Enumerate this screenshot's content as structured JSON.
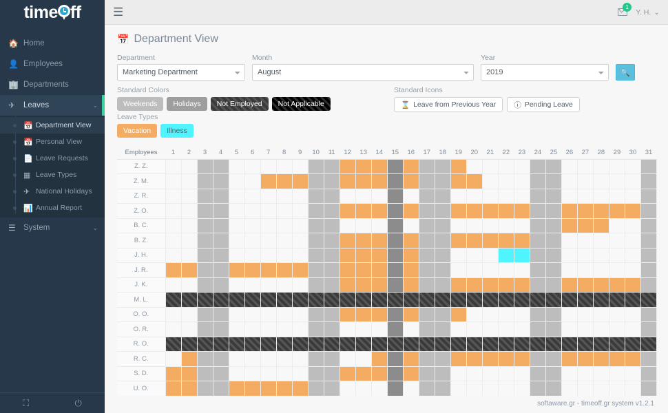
{
  "brand": {
    "name_part1": "time",
    "name_part2": "ff",
    "pin_icon": "location-pin-clock-icon"
  },
  "sidebar": {
    "items": [
      {
        "label": "Home",
        "icon": "home-icon"
      },
      {
        "label": "Employees",
        "icon": "id-card-icon"
      },
      {
        "label": "Departments",
        "icon": "building-icon"
      },
      {
        "label": "Leaves",
        "icon": "paper-plane-icon",
        "chevron": "⌄",
        "active": true
      }
    ],
    "subitems": [
      {
        "label": "Department View",
        "icon": "calendar-icon",
        "active": true
      },
      {
        "label": "Personal View",
        "icon": "calendar-icon",
        "active": false
      },
      {
        "label": "Leave Requests",
        "icon": "document-icon",
        "active": false
      },
      {
        "label": "Leave Types",
        "icon": "grid-icon",
        "active": false
      },
      {
        "label": "National Holidays",
        "icon": "airplane-icon",
        "active": false
      },
      {
        "label": "Annual Report",
        "icon": "bar-chart-icon",
        "active": false
      }
    ],
    "system": {
      "label": "System",
      "icon": "server-icon",
      "chevron": "⌄"
    },
    "bottom": {
      "fullscreen_icon": "expand-icon",
      "power_icon": "power-icon"
    }
  },
  "topbar": {
    "menu_icon": "hamburger-menu-icon",
    "mail_icon": "envelope-icon",
    "mail_badge": "1",
    "user_label": "Y. H.",
    "user_chevron": "⌄"
  },
  "page": {
    "title": "Department View",
    "title_icon": "calendar-icon"
  },
  "filters": {
    "department": {
      "label": "Department",
      "value": "Marketing Department"
    },
    "month": {
      "label": "Month",
      "value": "August"
    },
    "year": {
      "label": "Year",
      "value": "2019"
    },
    "search_icon": "search-icon"
  },
  "legend": {
    "standard_colors_title": "Standard Colors",
    "colors": [
      {
        "label": "Weekends",
        "color": "#bdbdbd"
      },
      {
        "label": "Holidays",
        "color": "#9e9e9e"
      },
      {
        "label": "Not Employed",
        "color": "#3a3a3a"
      },
      {
        "label": "Not Applicable",
        "color": "#000000"
      }
    ],
    "leave_types_title": "Leave Types",
    "leave_types": [
      {
        "label": "Vacation",
        "color": "#f3ac62"
      },
      {
        "label": "Illness",
        "color": "#4ff4ff"
      }
    ],
    "standard_icons_title": "Standard Icons",
    "icons": [
      {
        "label": "Leave from Previous Year",
        "icon": "hourglass-icon",
        "glyph": "⌛"
      },
      {
        "label": "Pending Leave",
        "icon": "clock-icon",
        "glyph": "ⓘ"
      }
    ]
  },
  "calendar": {
    "employees_header": "Employees",
    "days": [
      1,
      2,
      3,
      4,
      5,
      6,
      7,
      8,
      9,
      10,
      11,
      12,
      13,
      14,
      15,
      16,
      17,
      18,
      19,
      20,
      21,
      22,
      23,
      24,
      25,
      26,
      27,
      28,
      29,
      30,
      31
    ],
    "legend_key": {
      "e": "empty",
      "w": "weekend",
      "h": "holiday",
      "v": "vacation",
      "i": "illness",
      "n": "not-employed",
      "x": "not-applicable"
    },
    "rows": [
      {
        "name": "Z. Z.",
        "cells": [
          "e",
          "e",
          "w",
          "w",
          "e",
          "e",
          "e",
          "e",
          "e",
          "w",
          "w",
          "v",
          "v",
          "v",
          "h",
          "v",
          "w",
          "w",
          "v",
          "e",
          "e",
          "e",
          "e",
          "w",
          "w",
          "e",
          "e",
          "e",
          "e",
          "e",
          "w"
        ]
      },
      {
        "name": "Z. M.",
        "cells": [
          "e",
          "e",
          "w",
          "w",
          "e",
          "e",
          "v",
          "v",
          "v",
          "w",
          "w",
          "v",
          "v",
          "v",
          "h",
          "v",
          "w",
          "w",
          "v",
          "v",
          "e",
          "e",
          "e",
          "w",
          "w",
          "e",
          "e",
          "e",
          "e",
          "e",
          "w"
        ]
      },
      {
        "name": "Z. R.",
        "cells": [
          "e",
          "e",
          "w",
          "w",
          "e",
          "e",
          "e",
          "e",
          "e",
          "w",
          "w",
          "e",
          "e",
          "e",
          "h",
          "e",
          "w",
          "w",
          "e",
          "e",
          "e",
          "e",
          "e",
          "w",
          "w",
          "e",
          "e",
          "e",
          "e",
          "e",
          "w"
        ]
      },
      {
        "name": "Z. O.",
        "cells": [
          "e",
          "e",
          "w",
          "w",
          "e",
          "e",
          "e",
          "e",
          "e",
          "w",
          "w",
          "v",
          "v",
          "v",
          "h",
          "v",
          "w",
          "w",
          "v",
          "v",
          "v",
          "v",
          "v",
          "w",
          "w",
          "v",
          "v",
          "v",
          "v",
          "v",
          "w"
        ]
      },
      {
        "name": "B. C.",
        "cells": [
          "e",
          "e",
          "w",
          "w",
          "e",
          "e",
          "e",
          "e",
          "e",
          "w",
          "w",
          "e",
          "e",
          "e",
          "h",
          "e",
          "w",
          "w",
          "e",
          "e",
          "e",
          "e",
          "e",
          "w",
          "w",
          "v",
          "v",
          "v",
          "e",
          "e",
          "w"
        ]
      },
      {
        "name": "B. Z.",
        "cells": [
          "e",
          "e",
          "w",
          "w",
          "e",
          "e",
          "e",
          "e",
          "e",
          "w",
          "w",
          "v",
          "v",
          "v",
          "h",
          "v",
          "w",
          "w",
          "v",
          "v",
          "v",
          "v",
          "v",
          "w",
          "w",
          "e",
          "e",
          "e",
          "e",
          "e",
          "w"
        ]
      },
      {
        "name": "J. H.",
        "cells": [
          "e",
          "e",
          "w",
          "w",
          "e",
          "e",
          "e",
          "e",
          "e",
          "w",
          "w",
          "v",
          "v",
          "v",
          "h",
          "v",
          "w",
          "w",
          "e",
          "e",
          "e",
          "i",
          "i",
          "w",
          "w",
          "e",
          "e",
          "e",
          "e",
          "e",
          "w"
        ]
      },
      {
        "name": "J. R.",
        "cells": [
          "v",
          "v",
          "w",
          "w",
          "v",
          "v",
          "v",
          "v",
          "v",
          "w",
          "w",
          "v",
          "v",
          "v",
          "h",
          "v",
          "w",
          "w",
          "e",
          "e",
          "e",
          "e",
          "e",
          "w",
          "w",
          "e",
          "e",
          "e",
          "e",
          "e",
          "w"
        ]
      },
      {
        "name": "J. K.",
        "cells": [
          "e",
          "e",
          "w",
          "w",
          "e",
          "e",
          "e",
          "e",
          "e",
          "w",
          "w",
          "v",
          "v",
          "v",
          "h",
          "v",
          "w",
          "w",
          "v",
          "v",
          "v",
          "v",
          "v",
          "w",
          "w",
          "v",
          "v",
          "v",
          "v",
          "v",
          "w"
        ]
      },
      {
        "name": "M. L.",
        "cells": [
          "n",
          "n",
          "n",
          "n",
          "n",
          "n",
          "n",
          "n",
          "n",
          "n",
          "n",
          "n",
          "n",
          "n",
          "n",
          "n",
          "n",
          "n",
          "n",
          "n",
          "n",
          "n",
          "n",
          "n",
          "n",
          "n",
          "n",
          "n",
          "n",
          "n",
          "n"
        ]
      },
      {
        "name": "O. O.",
        "cells": [
          "e",
          "e",
          "w",
          "w",
          "e",
          "e",
          "e",
          "e",
          "e",
          "w",
          "w",
          "v",
          "v",
          "v",
          "h",
          "v",
          "w",
          "w",
          "v",
          "e",
          "e",
          "e",
          "e",
          "w",
          "w",
          "e",
          "e",
          "e",
          "e",
          "e",
          "w"
        ]
      },
      {
        "name": "O. R.",
        "cells": [
          "e",
          "e",
          "w",
          "w",
          "e",
          "e",
          "e",
          "e",
          "e",
          "w",
          "w",
          "e",
          "e",
          "e",
          "h",
          "e",
          "w",
          "w",
          "e",
          "e",
          "e",
          "e",
          "e",
          "w",
          "w",
          "e",
          "e",
          "e",
          "e",
          "e",
          "w"
        ]
      },
      {
        "name": "R. O.",
        "cells": [
          "n",
          "n",
          "n",
          "n",
          "n",
          "n",
          "n",
          "n",
          "n",
          "n",
          "n",
          "n",
          "n",
          "n",
          "n",
          "n",
          "n",
          "n",
          "n",
          "n",
          "n",
          "n",
          "n",
          "n",
          "n",
          "n",
          "n",
          "n",
          "n",
          "n",
          "n"
        ]
      },
      {
        "name": "R. C.",
        "cells": [
          "e",
          "v",
          "w",
          "w",
          "e",
          "e",
          "e",
          "e",
          "e",
          "w",
          "w",
          "e",
          "e",
          "v",
          "h",
          "v",
          "w",
          "w",
          "v",
          "v",
          "v",
          "v",
          "v",
          "w",
          "w",
          "v",
          "v",
          "v",
          "v",
          "v",
          "w"
        ]
      },
      {
        "name": "S. D.",
        "cells": [
          "v",
          "v",
          "w",
          "w",
          "e",
          "e",
          "e",
          "e",
          "e",
          "w",
          "w",
          "v",
          "v",
          "v",
          "h",
          "v",
          "w",
          "w",
          "e",
          "e",
          "e",
          "e",
          "e",
          "w",
          "w",
          "e",
          "e",
          "e",
          "e",
          "e",
          "w"
        ]
      },
      {
        "name": "U. O.",
        "cells": [
          "v",
          "v",
          "w",
          "w",
          "v",
          "v",
          "v",
          "v",
          "v",
          "w",
          "w",
          "e",
          "e",
          "e",
          "h",
          "e",
          "w",
          "w",
          "e",
          "e",
          "e",
          "e",
          "e",
          "w",
          "w",
          "e",
          "e",
          "e",
          "e",
          "e",
          "w"
        ]
      }
    ]
  },
  "footer": {
    "text": "softaware.gr - timeoff.gr system v1.2.1"
  }
}
